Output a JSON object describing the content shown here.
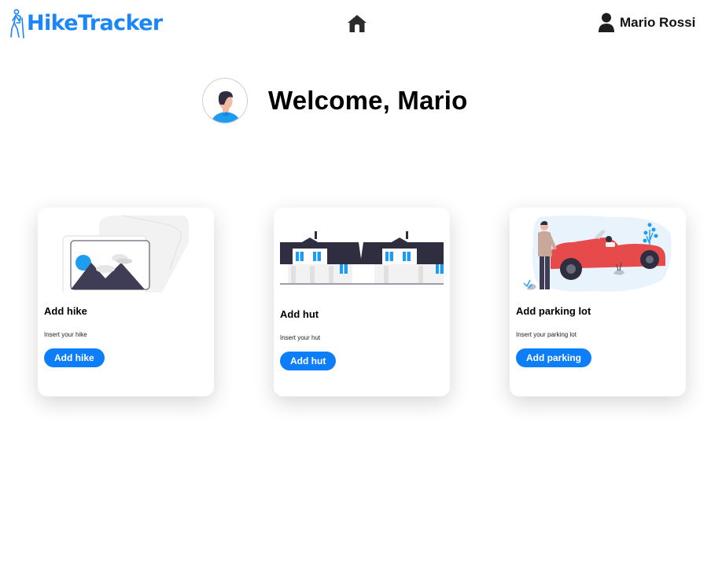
{
  "navbar": {
    "brand": "HikeTracker",
    "brand_icon": "hiker-icon",
    "home_icon": "home-icon",
    "user_icon": "user-icon",
    "user_name": "Mario Rossi",
    "brand_color": "#1a86f7"
  },
  "welcome": {
    "title": "Welcome, Mario",
    "avatar_icon": "avatar-icon"
  },
  "cards": [
    {
      "title": "Add hike",
      "text": "Insert your hike",
      "button": "Add hike",
      "image_icon": "image-placeholder-icon"
    },
    {
      "title": "Add hut",
      "text": "Insert your hut",
      "button": "Add hut",
      "image_icon": "houses-icon"
    },
    {
      "title": "Add parking lot",
      "text": "Insert your parking lot",
      "button": "Add parking",
      "image_icon": "car-parking-icon"
    }
  ],
  "colors": {
    "accent": "#0d7ef7",
    "dark": "#2f2e41",
    "car": "#e74a4a"
  }
}
